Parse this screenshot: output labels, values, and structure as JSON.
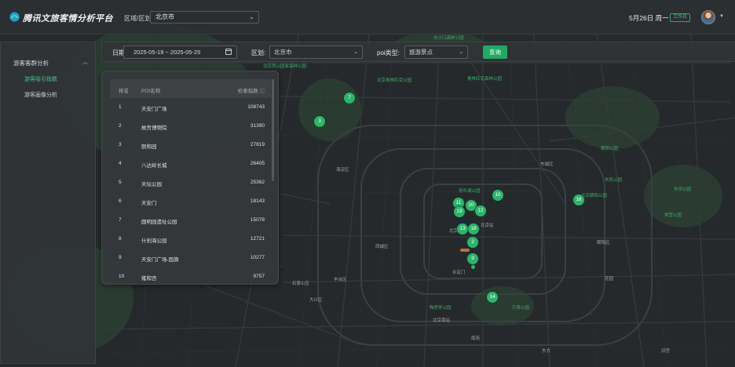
{
  "header": {
    "app_title": "腾讯文旅客情分析平台",
    "region_label": "区域/区划",
    "region_value": "北京市",
    "date_text": "5月26日 周一",
    "workday_badge": "工作日"
  },
  "sidebar": {
    "group_label": "游客客群分析",
    "items": [
      {
        "label": "游客吸引指数",
        "active": true
      },
      {
        "label": "游客画像分析",
        "active": false
      }
    ]
  },
  "filters": {
    "date_label": "日期:",
    "date_range": "2025-05-19 ~ 2025-05-25",
    "district_label": "区划:",
    "district_value": "北京市",
    "poi_type_label": "poi类型:",
    "poi_type_value": "旅游景点",
    "query_button": "查询"
  },
  "rank_table": {
    "headers": {
      "rank": "排名",
      "name": "POI名称",
      "index": "检索指数 ⓘ"
    },
    "rows": [
      {
        "rank": "1",
        "name": "天安门广场",
        "value": "108743"
      },
      {
        "rank": "2",
        "name": "故宫博物院",
        "value": "31390"
      },
      {
        "rank": "3",
        "name": "颐和园",
        "value": "27819"
      },
      {
        "rank": "4",
        "name": "八达岭长城",
        "value": "26405"
      },
      {
        "rank": "5",
        "name": "天坛公园",
        "value": "25362"
      },
      {
        "rank": "6",
        "name": "天安门",
        "value": "18143"
      },
      {
        "rank": "7",
        "name": "圆明园遗址公园",
        "value": "15078"
      },
      {
        "rank": "8",
        "name": "什刹海公园",
        "value": "12721"
      },
      {
        "rank": "9",
        "name": "天安门广场-国旗",
        "value": "10277"
      },
      {
        "rank": "10",
        "name": "雍和宫",
        "value": "9757"
      }
    ]
  },
  "map": {
    "markers": [
      "7",
      "3",
      "10",
      "16",
      "11",
      "20",
      "19",
      "12",
      "13",
      "18",
      "2",
      "9",
      "14"
    ],
    "labels": [
      "东小口森林公园",
      "北京西山国家森林公园",
      "北京奥林匹克公园",
      "奥林匹克森林公园",
      "北京朝阳公园",
      "东风公园",
      "朝阳公园",
      "东坝公园",
      "常营公园",
      "海淀区",
      "北京市",
      "西城区",
      "东城区",
      "朝阳区",
      "丰台区",
      "石景山区",
      "大兴区",
      "南苑",
      "北京南站",
      "北京站",
      "永定门",
      "陶然亭公园",
      "万寿公园",
      "青年湖公园",
      "花园",
      "东方",
      "旧宫"
    ]
  },
  "colors": {
    "accent": "#2fb36c",
    "panel": "#343839",
    "map_bg": "#262a2c"
  }
}
